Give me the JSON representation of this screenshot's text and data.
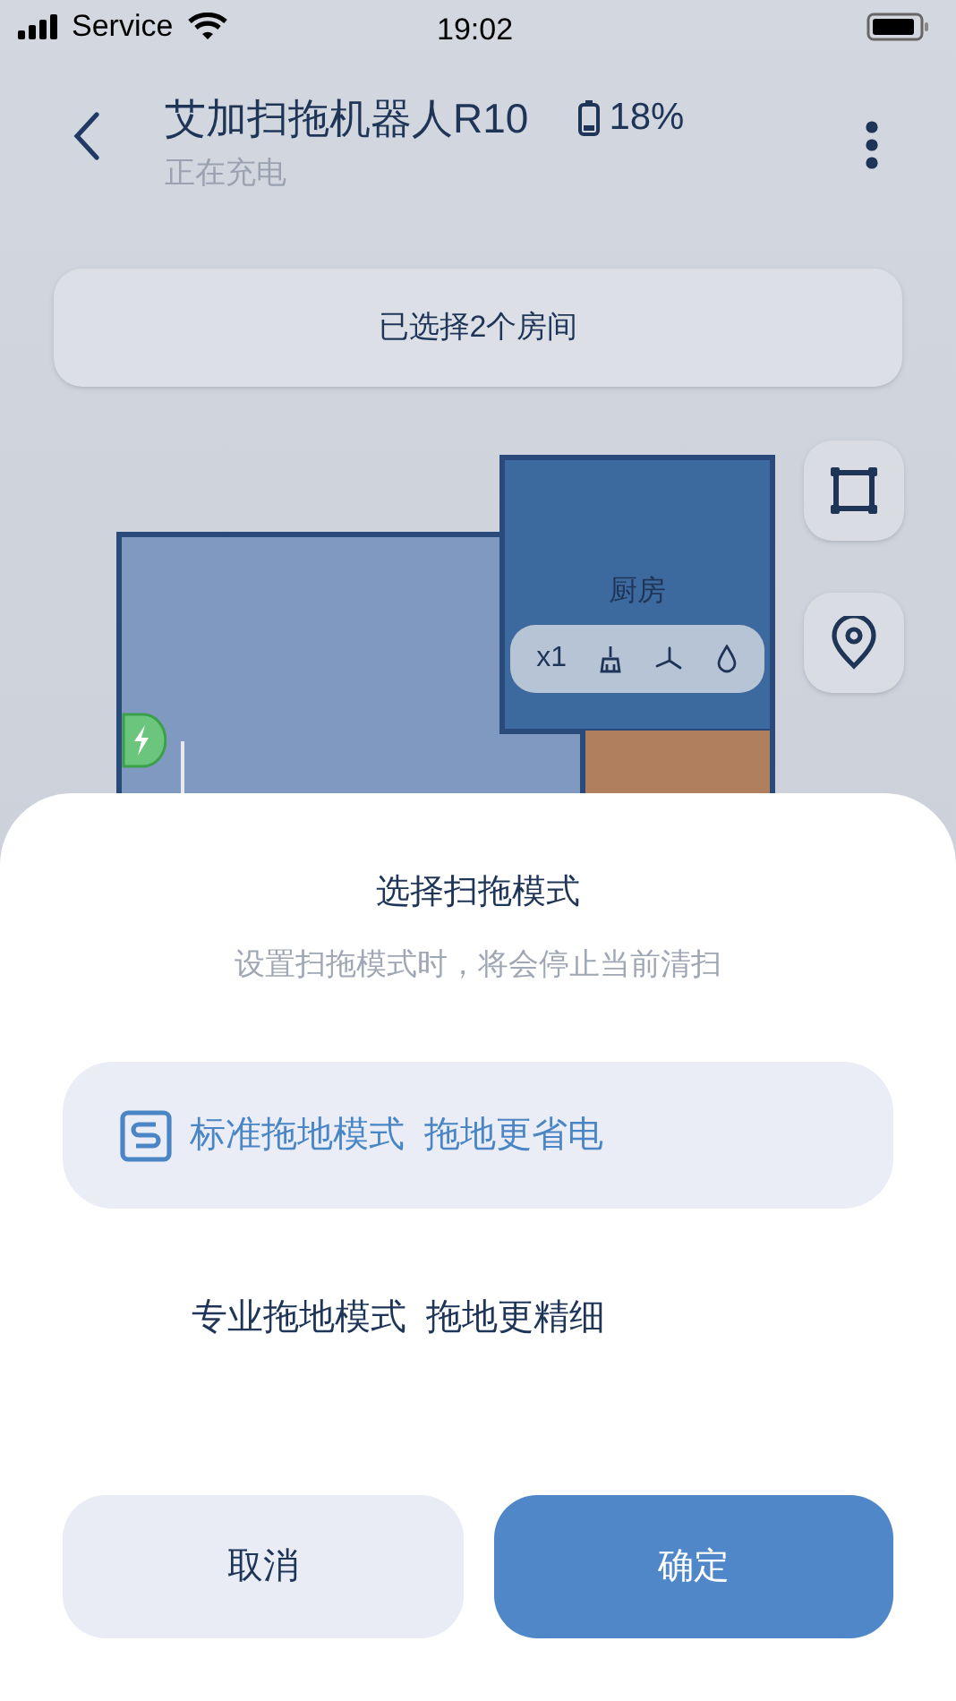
{
  "status_bar": {
    "carrier": "Service",
    "time": "19:02"
  },
  "header": {
    "title": "艾加扫拖机器人R10",
    "subtitle": "正在充电",
    "battery": "18%"
  },
  "selection_banner": "已选择2个房间",
  "map": {
    "rooms": [
      {
        "kind": "living"
      },
      {
        "kind": "kitchen",
        "label": "厨房",
        "settings": [
          "x1"
        ]
      },
      {
        "kind": "dining"
      }
    ]
  },
  "sheet": {
    "title": "选择扫拖模式",
    "subtitle": "设置扫拖模式时，将会停止当前清扫",
    "options": [
      {
        "name": "标准拖地模式",
        "note": "拖地更省电",
        "selected": true
      },
      {
        "name": "专业拖地模式",
        "note": "拖地更精细",
        "selected": false
      }
    ],
    "buttons": [
      {
        "kind": "cancel",
        "label": "取消"
      },
      {
        "kind": "confirm",
        "label": "确定"
      }
    ]
  }
}
